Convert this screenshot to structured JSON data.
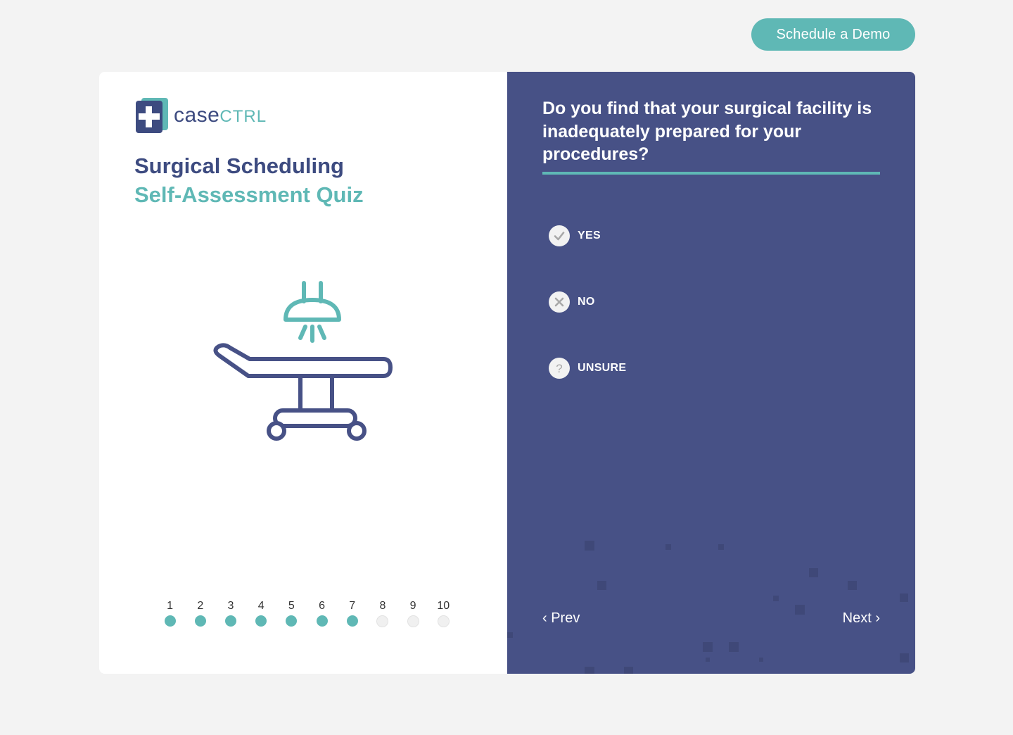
{
  "header": {
    "demo_button": "Schedule a Demo"
  },
  "brand": {
    "name_case": "case",
    "name_ctrl": "CTRL"
  },
  "quiz": {
    "title_line1": "Surgical Scheduling",
    "title_line2": "Self-Assessment Quiz",
    "question": "Do you find that your surgical facility is inadequately prepared for your procedures?",
    "options": [
      {
        "label": "YES",
        "icon": "check-icon"
      },
      {
        "label": "NO",
        "icon": "x-icon"
      },
      {
        "label": "UNSURE",
        "icon": "question-icon"
      }
    ],
    "nav": {
      "prev": "‹ Prev",
      "next": "Next ›"
    },
    "progress": {
      "current": 7,
      "total": 10,
      "steps": [
        "1",
        "2",
        "3",
        "4",
        "5",
        "6",
        "7",
        "8",
        "9",
        "10"
      ]
    }
  },
  "colors": {
    "accent": "#5fb8b5",
    "navy": "#475186",
    "brand_text": "#3d4b80"
  }
}
